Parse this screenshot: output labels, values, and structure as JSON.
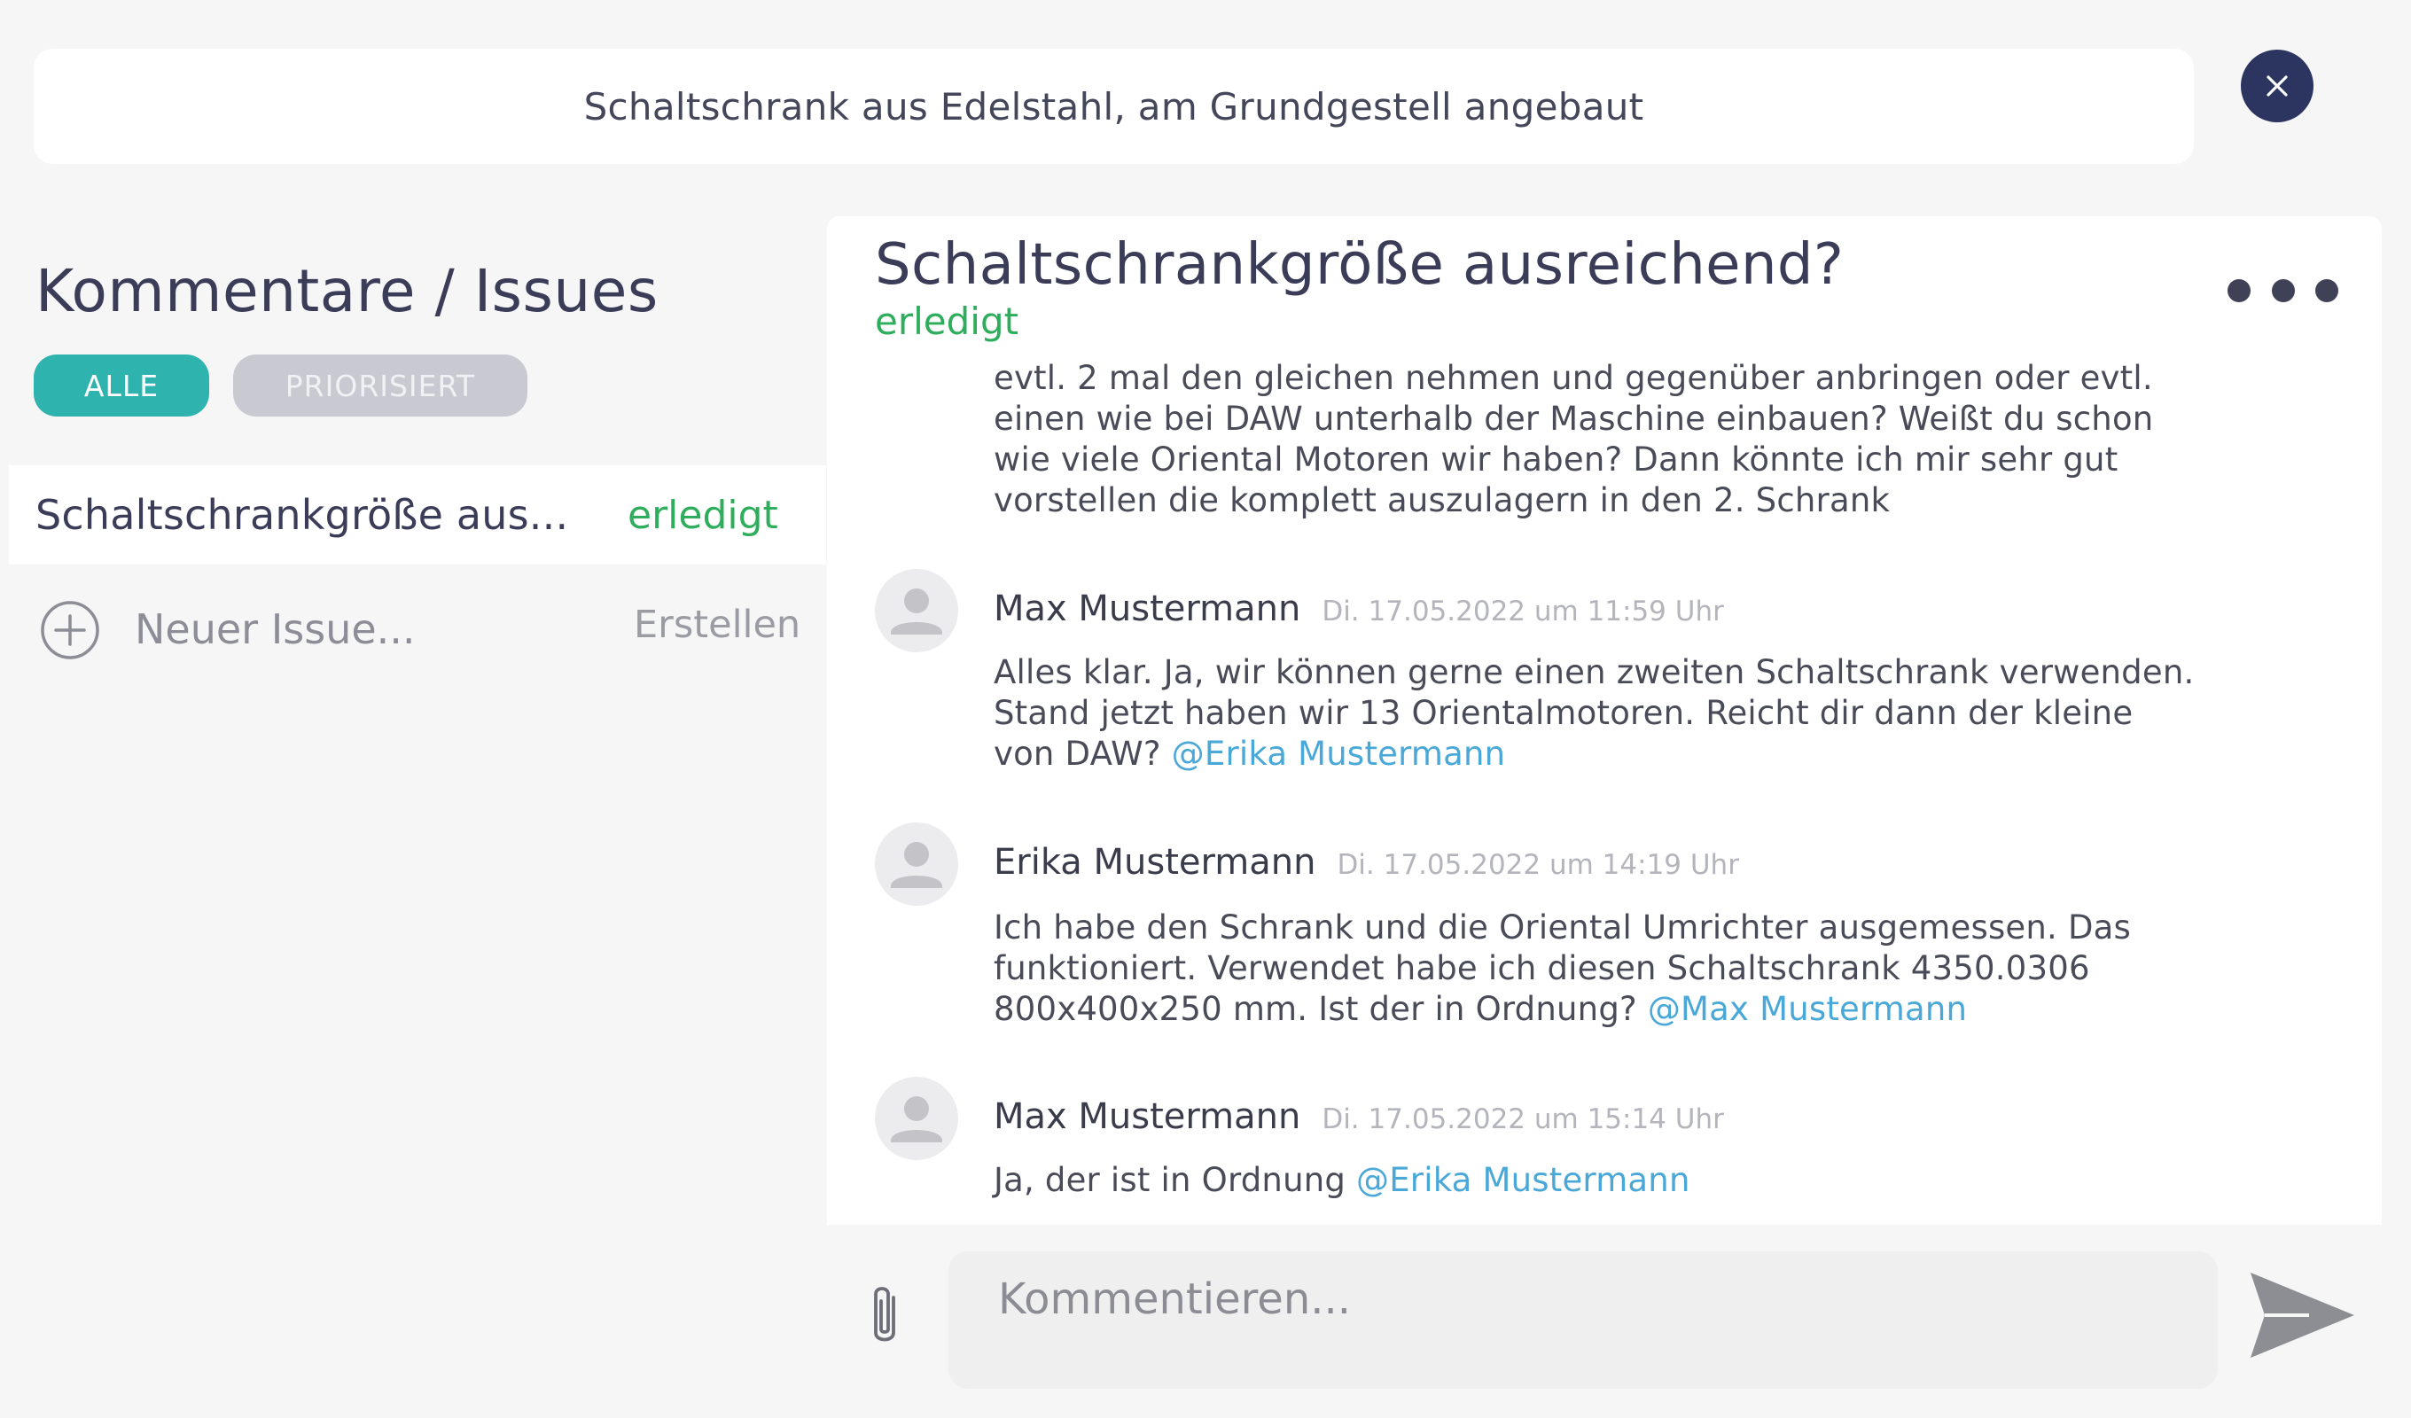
{
  "header": {
    "title": "Schaltschrank aus Edelstahl, am Grundgestell angebaut",
    "close_icon": "close-icon"
  },
  "sidebar": {
    "heading": "Kommentare / Issues",
    "filters": [
      {
        "label": "ALLE",
        "active": true
      },
      {
        "label": "PRIORISIERT",
        "active": false
      }
    ],
    "issues": [
      {
        "title": "Schaltschrankgröße aus...",
        "status": "erledigt"
      }
    ],
    "new_issue": {
      "placeholder": "Neuer Issue...",
      "create_label": "Erstellen"
    }
  },
  "thread": {
    "title": "Schaltschrankgröße ausreichend?",
    "status": "erledigt",
    "truncated_message": "evtl. 2 mal den gleichen nehmen und gegenüber anbringen oder evtl. einen wie bei DAW unterhalb der Maschine einbauen? Weißt du schon wie viele Oriental Motoren wir haben? Dann könnte ich mir sehr gut vorstellen die komplett auszulagern in den 2. Schrank",
    "messages": [
      {
        "author": "Max Mustermann",
        "timestamp": "Di. 17.05.2022 um 11:59 Uhr",
        "text": "Alles klar. Ja, wir können gerne einen zweiten Schaltschrank verwenden. Stand jetzt haben wir 13 Orientalmotoren. Reicht dir dann der kleine von DAW?",
        "mention": "@Erika Mustermann"
      },
      {
        "author": "Erika Mustermann",
        "timestamp": "Di. 17.05.2022 um 14:19 Uhr",
        "text": "Ich habe den Schrank und die Oriental Umrichter ausgemessen. Das funktioniert. Verwendet habe ich diesen Schaltschrank 4350.0306 800x400x250 mm. Ist der in Ordnung?",
        "mention": "@Max Mustermann"
      },
      {
        "author": "Max Mustermann",
        "timestamp": "Di. 17.05.2022 um 15:14 Uhr",
        "text": "Ja, der ist in Ordnung",
        "mention": "@Erika Mustermann"
      }
    ]
  },
  "composer": {
    "placeholder": "Kommentieren...",
    "attach_icon": "paperclip-icon",
    "send_icon": "send-icon"
  },
  "colors": {
    "accent": "#2fb3ae",
    "status_done": "#2eae5c",
    "mention": "#4aa8d8",
    "close_button": "#2c3460"
  }
}
